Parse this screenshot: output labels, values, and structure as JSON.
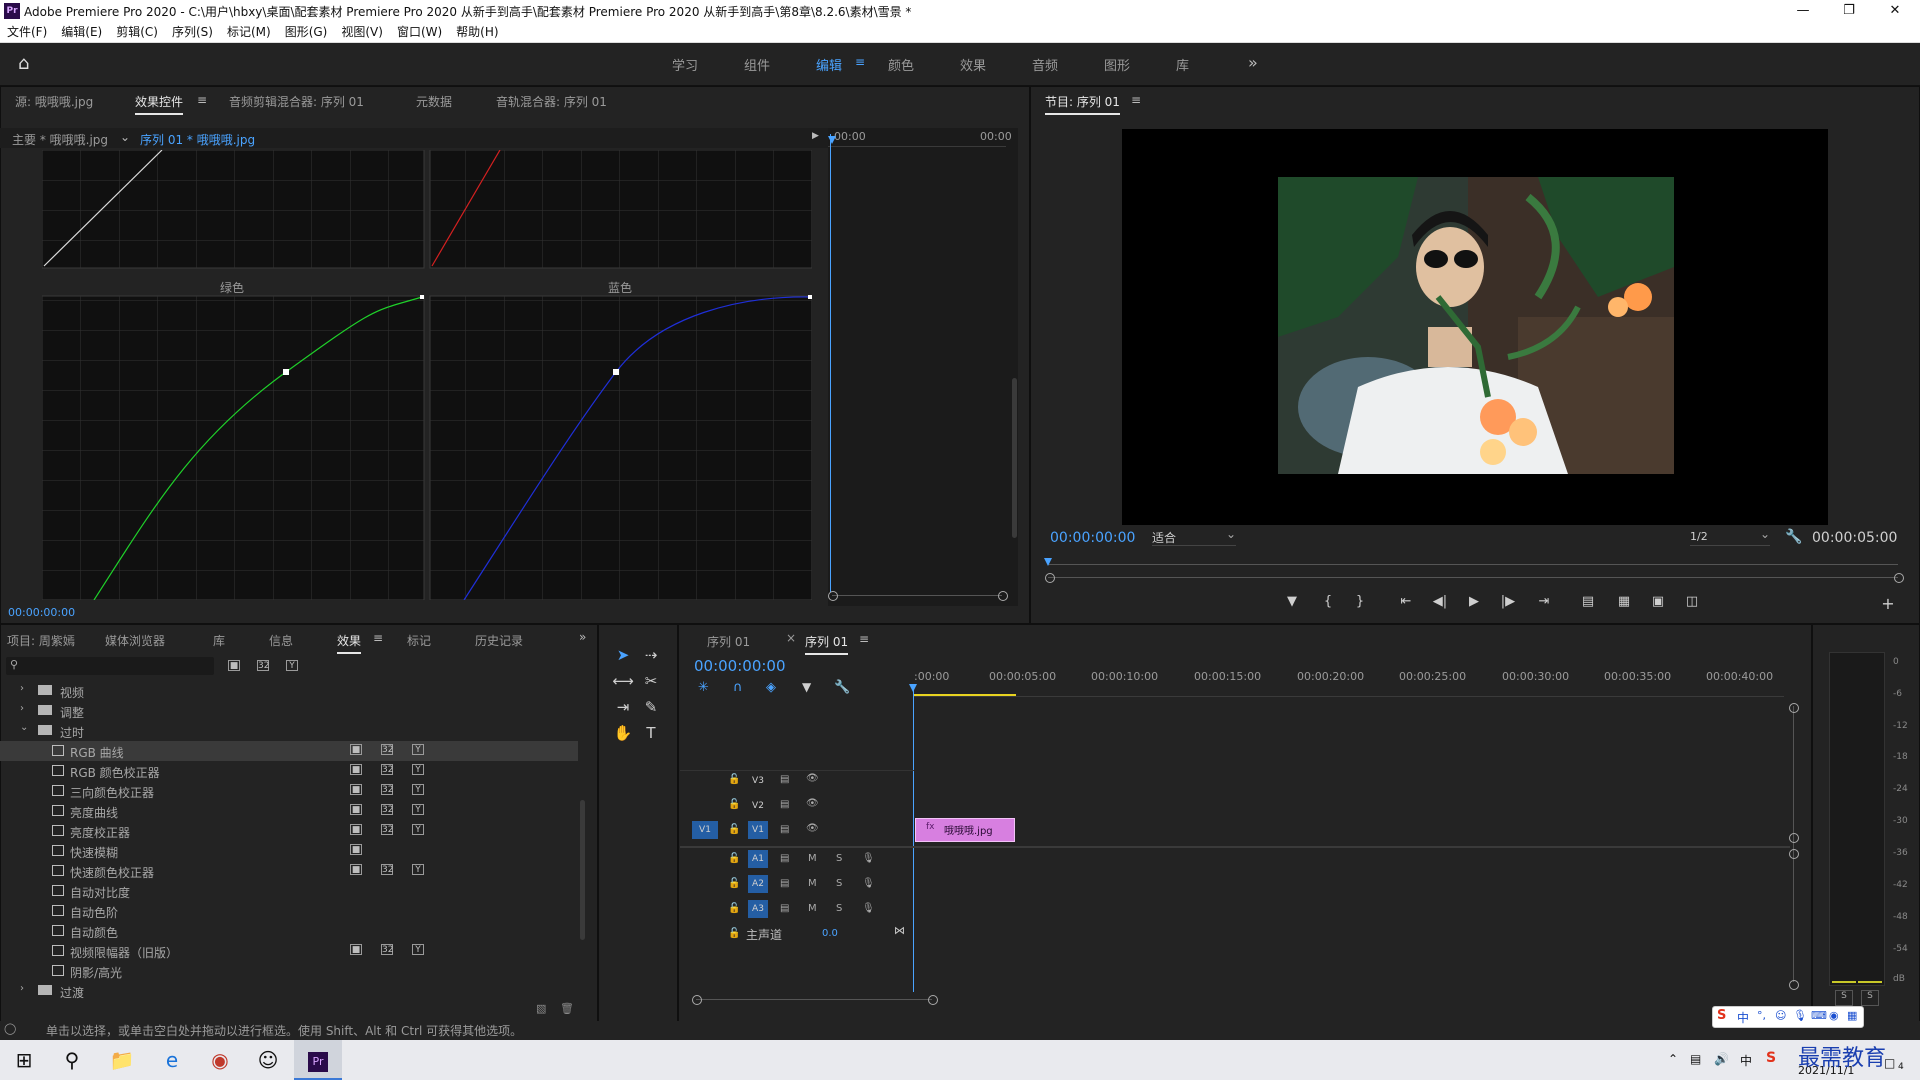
{
  "window": {
    "title": "Adobe Premiere Pro 2020 - C:\\用户\\hbxy\\桌面\\配套素材 Premiere Pro 2020 从新手到高手\\配套素材 Premiere Pro 2020 从新手到高手\\第8章\\8.2.6\\素材\\雪景 *",
    "app_badge": "Pr"
  },
  "menu": [
    "文件(F)",
    "编辑(E)",
    "剪辑(C)",
    "序列(S)",
    "标记(M)",
    "图形(G)",
    "视图(V)",
    "窗口(W)",
    "帮助(H)"
  ],
  "workspaces": [
    {
      "label": "学习",
      "active": false
    },
    {
      "label": "组件",
      "active": false
    },
    {
      "label": "编辑",
      "active": true
    },
    {
      "label": "颜色",
      "active": false
    },
    {
      "label": "效果",
      "active": false
    },
    {
      "label": "音频",
      "active": false
    },
    {
      "label": "图形",
      "active": false
    },
    {
      "label": "库",
      "active": false
    }
  ],
  "top_left_panel": {
    "tabs": [
      "源: 哦哦哦.jpg",
      "效果控件",
      "音频剪辑混合器: 序列 01",
      "元数据",
      "音轨混合器: 序列 01"
    ],
    "master_label": "主要 * 哦哦哦.jpg",
    "clip_label": "序列 01 * 哦哦哦.jpg",
    "mini_tc_start": "00:00",
    "mini_tc_end": "00:00",
    "curve_labels": {
      "green": "绿色",
      "blue": "蓝色"
    },
    "timecode": "00:00:00:00"
  },
  "program_monitor": {
    "title": "节目: 序列 01",
    "timecode": "00:00:00:00",
    "fit": "适合",
    "resolution": "1/2",
    "duration": "00:00:05:00"
  },
  "bottom_left_panel": {
    "tabs": [
      "项目: 周紫嫣",
      "媒体浏览器",
      "库",
      "信息",
      "效果",
      "标记",
      "历史记录"
    ],
    "search_placeholder": "",
    "items": [
      {
        "label": "视频",
        "type": "folder",
        "expanded": false,
        "indent": 0
      },
      {
        "label": "调整",
        "type": "folder",
        "expanded": false,
        "indent": 0
      },
      {
        "label": "过时",
        "type": "folder",
        "expanded": true,
        "indent": 0
      },
      {
        "label": "RGB 曲线",
        "type": "effect",
        "selected": true,
        "accel": 3
      },
      {
        "label": "RGB 颜色校正器",
        "type": "effect",
        "accel": 3
      },
      {
        "label": "三向颜色校正器",
        "type": "effect",
        "accel": 3
      },
      {
        "label": "亮度曲线",
        "type": "effect",
        "accel": 3
      },
      {
        "label": "亮度校正器",
        "type": "effect",
        "accel": 3
      },
      {
        "label": "快速模糊",
        "type": "effect",
        "accel": 1
      },
      {
        "label": "快速颜色校正器",
        "type": "effect",
        "accel": 3
      },
      {
        "label": "自动对比度",
        "type": "effect",
        "accel": 0
      },
      {
        "label": "自动色阶",
        "type": "effect",
        "accel": 0
      },
      {
        "label": "自动颜色",
        "type": "effect",
        "accel": 0
      },
      {
        "label": "视频限幅器（旧版）",
        "type": "effect",
        "accel": 3
      },
      {
        "label": "阴影/高光",
        "type": "effect",
        "accel": 0
      },
      {
        "label": "过渡",
        "type": "folder",
        "expanded": false,
        "indent": 0
      }
    ]
  },
  "timeline": {
    "tabs": [
      "序列 01",
      "序列 01"
    ],
    "timecode": "00:00:00:00",
    "ticks": [
      ":00:00",
      "00:00:05:00",
      "00:00:10:00",
      "00:00:15:00",
      "00:00:20:00",
      "00:00:25:00",
      "00:00:30:00",
      "00:00:35:00",
      "00:00:40:00"
    ],
    "video_tracks": [
      "V3",
      "V2",
      "V1"
    ],
    "audio_tracks": [
      "A1",
      "A2",
      "A3"
    ],
    "source_patch": "V1",
    "master": {
      "label": "主声道",
      "value": "0.0"
    },
    "clip": {
      "label": "哦哦哦.jpg",
      "fx": "fx",
      "color": "#d77fe0"
    },
    "mute": "M",
    "solo": "S"
  },
  "meter": {
    "scale": [
      "0",
      "-6",
      "-12",
      "-18",
      "-24",
      "-30",
      "-36",
      "-42",
      "-48",
      "-54",
      "dB"
    ],
    "solo_left": "S",
    "solo_right": "S"
  },
  "status_bar": "单击以选择，或单击空白处并拖动以进行框选。使用 Shift、Alt 和 Ctrl 可获得其他选项。",
  "taskbar": {
    "date": "2021/11/1",
    "ime": "中",
    "watermark": "最需教育",
    "notif_count": "4"
  },
  "colors": {
    "accent": "#4aa3ff",
    "panel_bg": "#232323",
    "track_highlight": "#245ea4",
    "green_curve": "#1fd12a",
    "blue_curve": "#1f2fd8",
    "red_curve": "#d42020"
  }
}
